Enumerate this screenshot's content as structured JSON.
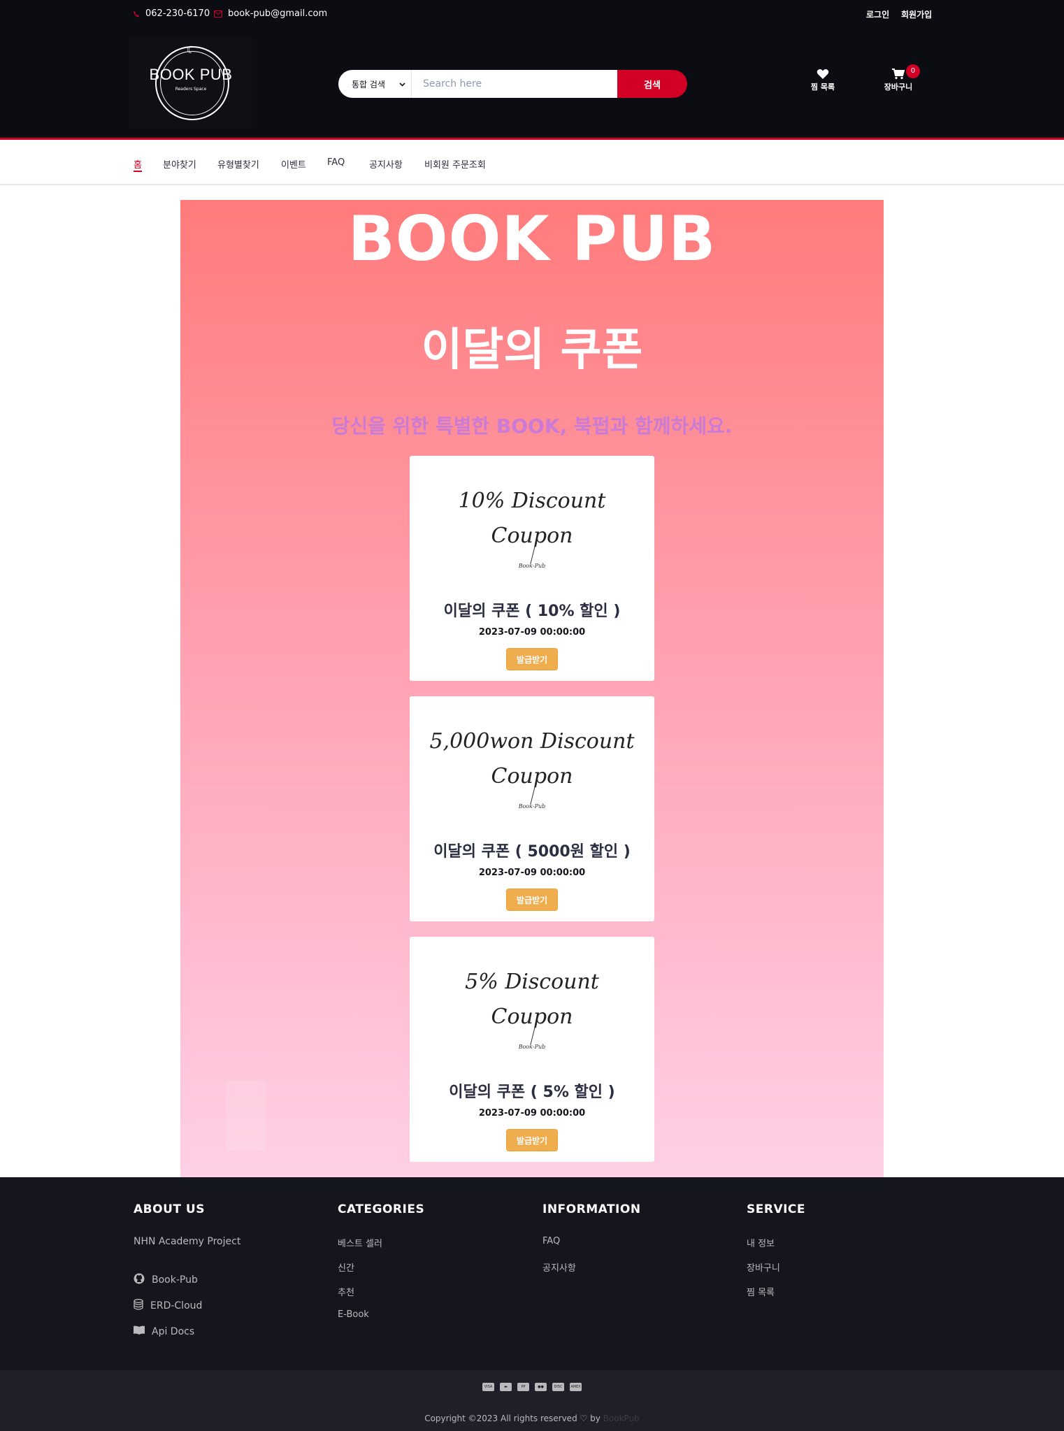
{
  "topbar": {
    "phone": "062-230-6170",
    "email": "book-pub@gmail.com",
    "login": "로그인",
    "signup": "회원가입"
  },
  "logo": {
    "title": "BOOK PUB",
    "tagline": "Readers Space"
  },
  "search": {
    "category": "통합 검색",
    "placeholder": "Search here",
    "button": "검색"
  },
  "header_icons": {
    "wishlist": "찜 목록",
    "cart": "장바구니",
    "cart_count": "0"
  },
  "nav": {
    "items": [
      "홈",
      "분야찾기",
      "유형별찾기",
      "이벤트",
      "FAQ",
      "공지사항",
      "비회원 주문조회"
    ],
    "active": "홈"
  },
  "hero": {
    "title": "BOOK PUB",
    "subtitle": "이달의 쿠폰",
    "tagline": "당신을 위한 특별한 BOOK, 북펍과 함께하세요."
  },
  "coupons": [
    {
      "script_line1": "10% Discount",
      "script_line2": "Coupon",
      "script_brand": "Book-Pub",
      "name": "이달의 쿠폰 ( 10% 할인 )",
      "date": "2023-07-09 00:00:00",
      "button": "발급받기"
    },
    {
      "script_line1": "5,000won Discount",
      "script_line2": "Coupon",
      "script_brand": "Book-Pub",
      "name": "이달의 쿠폰 ( 5000원 할인 )",
      "date": "2023-07-09 00:00:00",
      "button": "발급받기"
    },
    {
      "script_line1": "5% Discount",
      "script_line2": "Coupon",
      "script_brand": "Book-Pub",
      "name": "이달의 쿠폰 ( 5% 할인 )",
      "date": "2023-07-09 00:00:00",
      "button": "발급받기"
    }
  ],
  "footer": {
    "about": {
      "heading": "ABOUT US",
      "text": "NHN Academy Project",
      "links": [
        {
          "icon": "github-icon",
          "label": "Book-Pub"
        },
        {
          "icon": "database-icon",
          "label": "ERD-Cloud"
        },
        {
          "icon": "book-icon",
          "label": "Api Docs"
        }
      ]
    },
    "categories": {
      "heading": "CATEGORIES",
      "links": [
        "베스트 셀러",
        "신간",
        "추천",
        "E-Book"
      ]
    },
    "information": {
      "heading": "INFORMATION",
      "links": [
        "FAQ",
        "공지사항"
      ]
    },
    "service": {
      "heading": "SERVICE",
      "links": [
        "내 정보",
        "장바구니",
        "찜 목록"
      ]
    }
  },
  "bottom": {
    "payments": [
      "visa-icon",
      "credit-card-icon",
      "paypal-icon",
      "mastercard-icon",
      "discover-icon",
      "amex-icon"
    ],
    "copyright_prefix": "Copyright ©2023 All rights reserved",
    "copyright_by": "by",
    "copyright_brand": "BookPub"
  },
  "colors": {
    "accent": "#d10024",
    "dark": "#15161d",
    "header_bg": "#0c0d13",
    "button_orange": "#f0ad4e",
    "tagline": "#c97bd6"
  }
}
